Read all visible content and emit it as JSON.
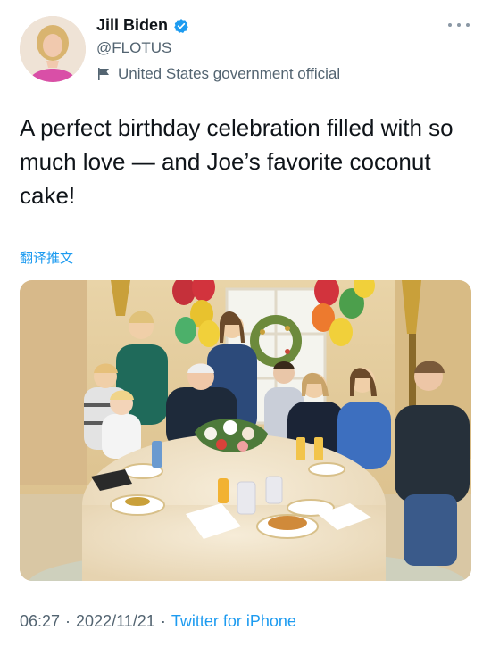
{
  "author": {
    "name": "Jill Biden",
    "handle": "@FLOTUS",
    "label": "United States government official",
    "verified_icon": "verified-badge-icon",
    "label_icon": "flag-icon"
  },
  "tweet": {
    "text": "A perfect birthday celebration filled with so much love — and Joe’s favorite coconut cake!",
    "translate_label": "翻译推文"
  },
  "meta": {
    "time": "06:27",
    "date": "2022/11/21",
    "source": "Twitter for iPhone"
  },
  "colors": {
    "accent": "#1d9bf0",
    "text": "#0f1419",
    "secondary": "#536471"
  }
}
